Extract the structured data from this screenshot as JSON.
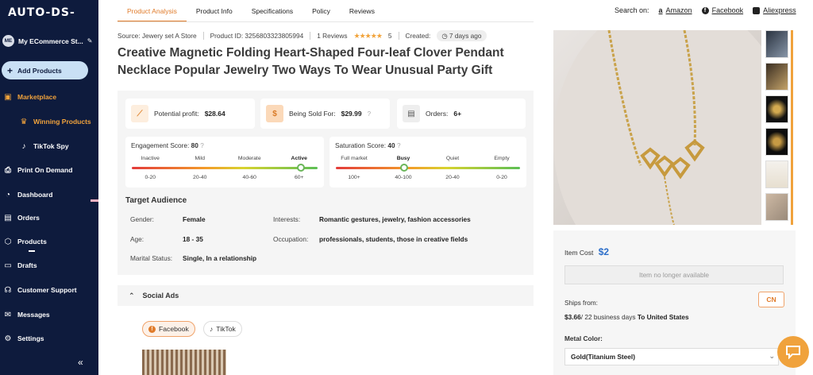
{
  "logo": "AUTO-DS-",
  "sidebar": {
    "store": {
      "initials": "ME",
      "name": "My ECommerce St..."
    },
    "add_products": "Add Products",
    "marketplace": "Marketplace",
    "winning_products": "Winning Products",
    "tiktok_spy": "TikTok Spy",
    "items": [
      "Print On Demand",
      "Dashboard",
      "Orders",
      "Products",
      "Drafts",
      "Customer Support",
      "Messages",
      "Settings"
    ],
    "collapse": "«"
  },
  "tabs": [
    "Product Analysis",
    "Product Info",
    "Specifications",
    "Policy",
    "Reviews"
  ],
  "search_on": {
    "label": "Search on:",
    "links": [
      "Amazon",
      "Facebook",
      "Aliexpress"
    ]
  },
  "meta": {
    "source": "Source: Jewery set A Store",
    "product_id": "Product ID: 3256803323805994",
    "reviews": "1 Reviews",
    "stars": "★★★★★",
    "rating": "5",
    "created_label": "Created:",
    "created_value": "7 days ago"
  },
  "title": "Creative Magnetic Folding Heart-Shaped Four-leaf Clover Pendant Necklace Popular Jewelry Two Ways To Wear Unusual Party Gift",
  "cards": {
    "profit": {
      "label": "Potential profit:",
      "value": "$28.64"
    },
    "sold_for": {
      "label": "Being Sold For:",
      "value": "$29.99"
    },
    "orders": {
      "label": "Orders:",
      "value": "6+"
    }
  },
  "engagement": {
    "label": "Engagement Score:",
    "value": "80",
    "levels": [
      "Inactive",
      "Mild",
      "Moderate",
      "Active"
    ],
    "ranges": [
      "0-20",
      "20-40",
      "40-60",
      "60+"
    ],
    "active_index": 3
  },
  "saturation": {
    "label": "Saturation Score:",
    "value": "40",
    "levels": [
      "Full market",
      "Busy",
      "Quiet",
      "Empty"
    ],
    "ranges": [
      "100+",
      "40-100",
      "20-40",
      "0-20"
    ],
    "active_index": 1
  },
  "audience": {
    "title": "Target Audience",
    "gender_label": "Gender:",
    "gender": "Female",
    "age_label": "Age:",
    "age": "18 - 35",
    "marital_label": "Marital Status:",
    "marital": "Single, In a relationship",
    "interests_label": "Interests:",
    "interests": "Romantic gestures, jewelry, fashion accessories",
    "occupation_label": "Occupation:",
    "occupation": "professionals, students, those in creative fields"
  },
  "social": {
    "title": "Social Ads",
    "platforms": [
      "Facebook",
      "TikTok"
    ]
  },
  "purchase": {
    "item_cost_label": "Item Cost",
    "item_cost": "$2",
    "unavailable": "Item no longer available",
    "ships_from": "Ships from:",
    "ships_origin": "CN",
    "ship_price": "$3.66",
    "ship_days": "/ 22 business days",
    "ship_to": "To United States",
    "metal_color_label": "Metal Color:",
    "metal_color": "Gold(Titanium Steel)"
  },
  "colors": {
    "sidebar": "#0e1b3d",
    "accent": "#e07b2a",
    "price": "#2c6ec9"
  }
}
